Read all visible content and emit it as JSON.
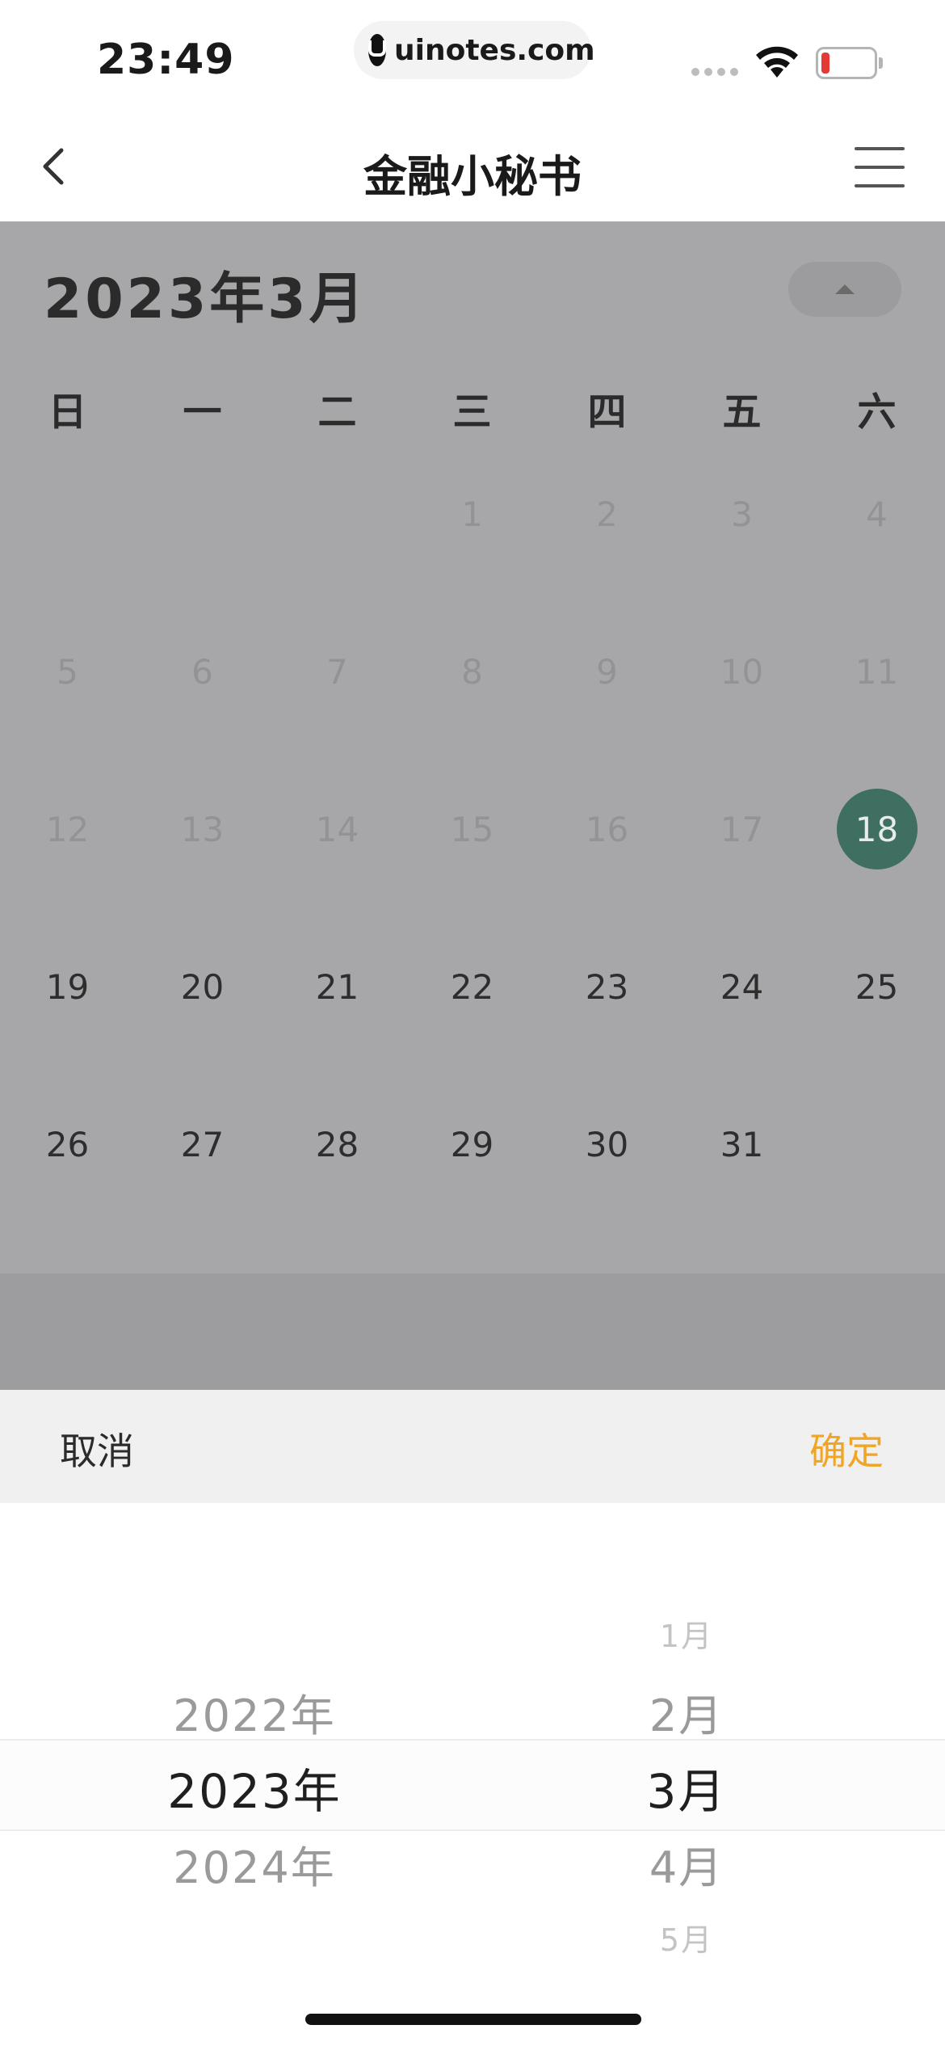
{
  "status_bar": {
    "time": "23:49",
    "url": "uinotes.com"
  },
  "nav": {
    "title": "金融小秘书"
  },
  "calendar": {
    "month_title": "2023年3月",
    "weekdays": [
      "日",
      "一",
      "二",
      "三",
      "四",
      "五",
      "六"
    ],
    "weeks": [
      [
        "",
        "",
        "",
        "1",
        "2",
        "3",
        "4"
      ],
      [
        "5",
        "6",
        "7",
        "8",
        "9",
        "10",
        "11"
      ],
      [
        "12",
        "13",
        "14",
        "15",
        "16",
        "17",
        "18"
      ],
      [
        "19",
        "20",
        "21",
        "22",
        "23",
        "24",
        "25"
      ],
      [
        "26",
        "27",
        "28",
        "29",
        "30",
        "31",
        ""
      ]
    ],
    "selected_day": "18",
    "muted_until_day": 17
  },
  "picker": {
    "cancel_label": "取消",
    "confirm_label": "确定",
    "years": [
      "2022年",
      "2023年",
      "2024年"
    ],
    "selected_year_index": 1,
    "months": [
      "1月",
      "2月",
      "3月",
      "4月",
      "5月"
    ],
    "selected_month_index": 2
  },
  "colors": {
    "confirm": "#f0a526",
    "selected_day": "#3e6f60",
    "overlay": "#a7a7a9"
  }
}
